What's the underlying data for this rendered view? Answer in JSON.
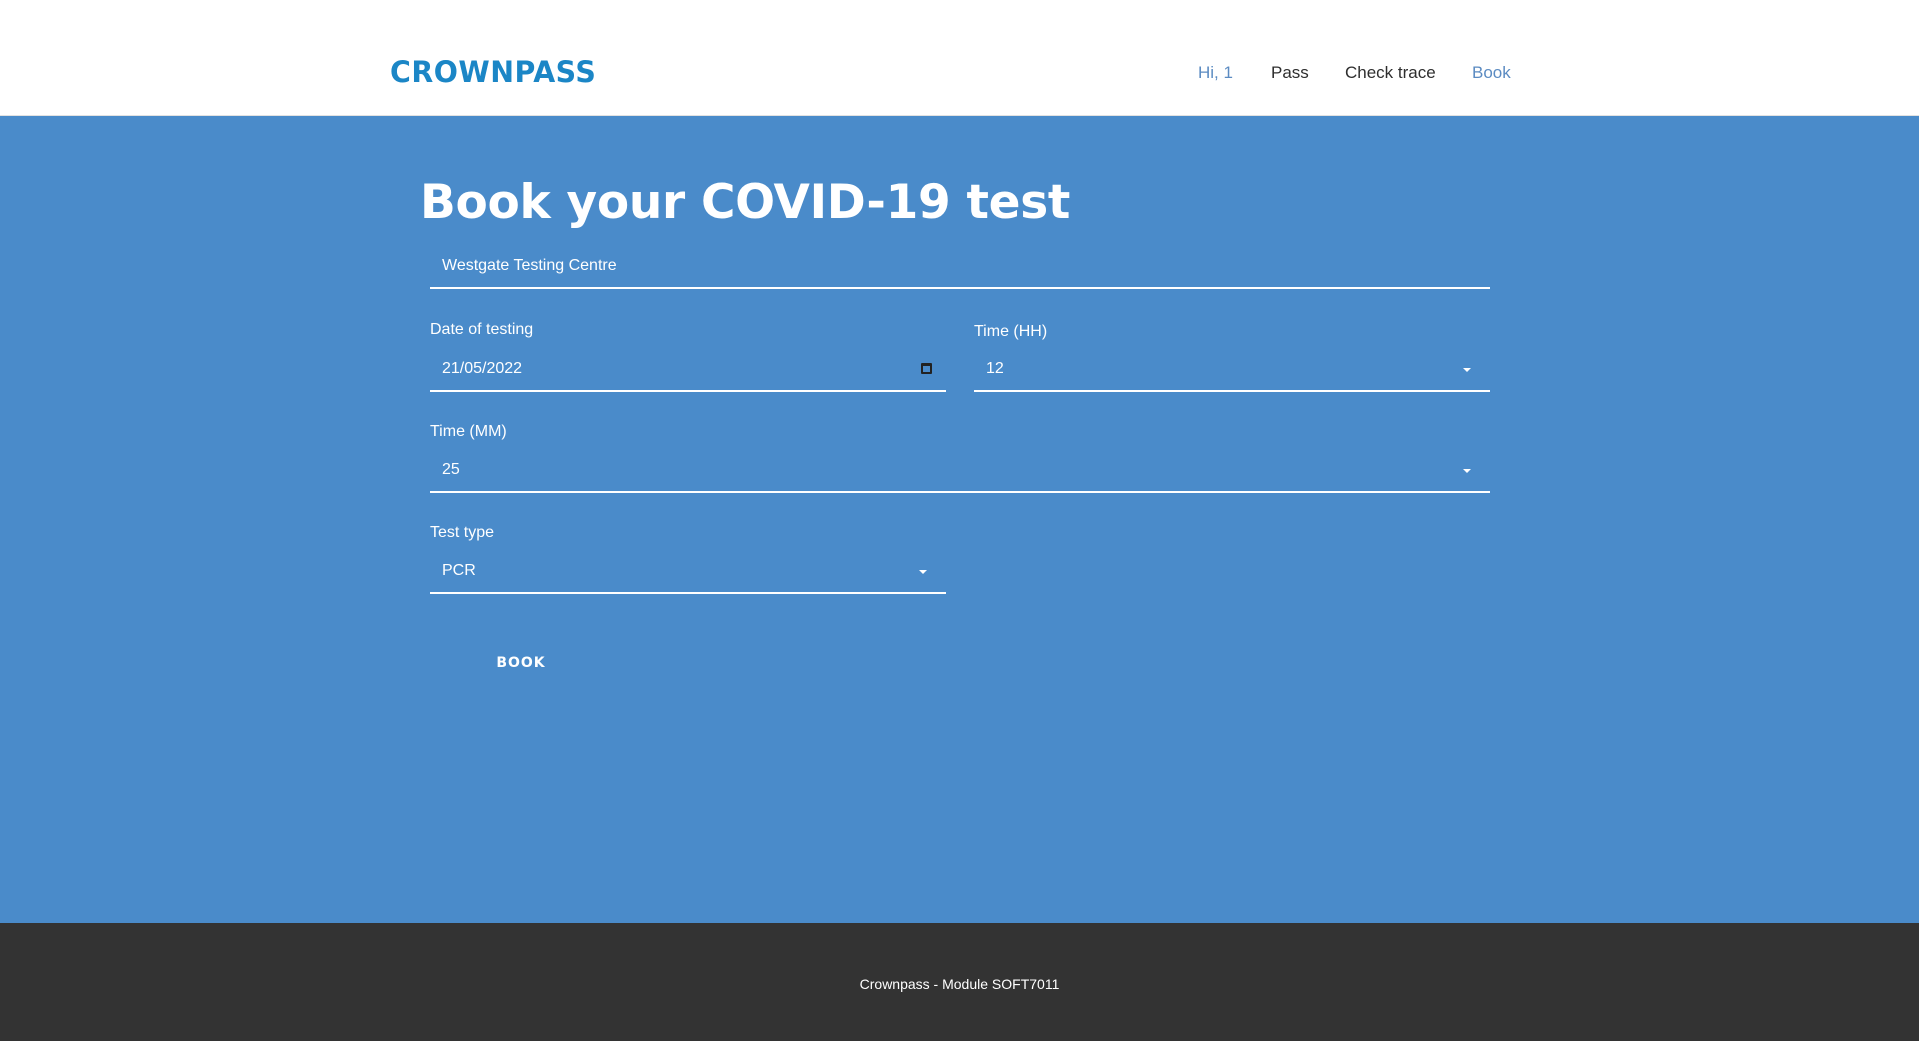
{
  "header": {
    "logo": "CROWNPASS",
    "nav": {
      "greeting": "Hi, 1",
      "pass": "Pass",
      "check_trace": "Check trace",
      "book": "Book"
    }
  },
  "main": {
    "title": "Book your COVID-19 test",
    "location": "Westgate Testing Centre",
    "date": {
      "label": "Date of testing",
      "value": "21/05/2022"
    },
    "time_hh": {
      "label": "Time (HH)",
      "value": "12"
    },
    "time_mm": {
      "label": "Time (MM)",
      "value": "25"
    },
    "test_type": {
      "label": "Test type",
      "value": "PCR"
    },
    "book_label": "BOOK"
  },
  "footer": {
    "text": "Crownpass - Module SOFT7011"
  },
  "colors": {
    "brand": "#1b86c6",
    "background": "#4a8bca",
    "nav_active": "#5b8bc2",
    "footer": "#333333"
  },
  "icons": {
    "date_picker": "calendar-icon",
    "dropdown": "caret-down-icon"
  }
}
